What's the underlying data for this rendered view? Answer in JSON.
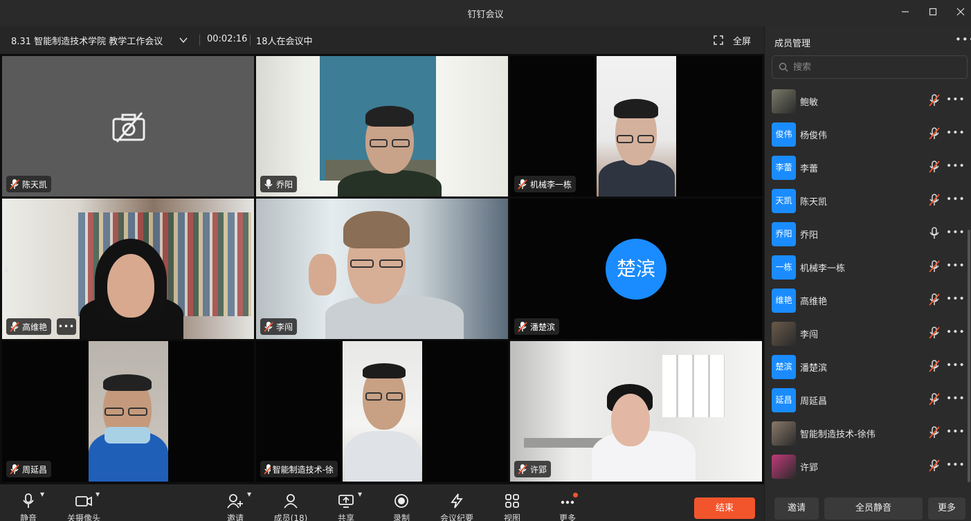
{
  "window": {
    "title": "钉钉会议"
  },
  "meeting": {
    "title": "8.31 智能制造技术学院 教学工作会议",
    "timer": "00:02:16",
    "participants_text": "18人在会议中",
    "fullscreen_label": "全屏"
  },
  "tiles": [
    {
      "name": "陈天凯",
      "mic": "muted",
      "camera": "off"
    },
    {
      "name": "乔阳",
      "mic": "on",
      "camera": "on"
    },
    {
      "name": "机械李一栋",
      "mic": "muted",
      "camera": "on"
    },
    {
      "name": "高维艳",
      "mic": "muted",
      "camera": "on",
      "more": "•••"
    },
    {
      "name": "李闯",
      "mic": "muted",
      "camera": "on"
    },
    {
      "name": "潘楚滨",
      "mic": "muted",
      "camera": "off",
      "avatar": "楚滨"
    },
    {
      "name": "周延昌",
      "mic": "muted",
      "camera": "on"
    },
    {
      "name": "智能制造技术-徐",
      "mic": "muted",
      "camera": "on"
    },
    {
      "name": "许郢",
      "mic": "muted",
      "camera": "on"
    }
  ],
  "sidebar": {
    "title": "成员管理",
    "more": "•••",
    "search_placeholder": "搜索",
    "members": [
      {
        "name": "鲍敏",
        "avatar": "",
        "avatar_type": "photo",
        "mic": "muted"
      },
      {
        "name": "杨俊伟",
        "avatar": "俊伟",
        "avatar_type": "text",
        "mic": "muted"
      },
      {
        "name": "李蕾",
        "avatar": "李蕾",
        "avatar_type": "text",
        "mic": "muted"
      },
      {
        "name": "陈天凯",
        "avatar": "天凯",
        "avatar_type": "text",
        "mic": "muted"
      },
      {
        "name": "乔阳",
        "avatar": "乔阳",
        "avatar_type": "text",
        "mic": "on"
      },
      {
        "name": "机械李一栋",
        "avatar": "一栋",
        "avatar_type": "text",
        "mic": "muted"
      },
      {
        "name": "高维艳",
        "avatar": "维艳",
        "avatar_type": "text",
        "mic": "muted"
      },
      {
        "name": "李闯",
        "avatar": "",
        "avatar_type": "photo",
        "mic": "muted"
      },
      {
        "name": "潘楚滨",
        "avatar": "楚滨",
        "avatar_type": "text",
        "mic": "muted"
      },
      {
        "name": "周延昌",
        "avatar": "延昌",
        "avatar_type": "text",
        "mic": "muted"
      },
      {
        "name": "智能制造技术-徐伟",
        "avatar": "",
        "avatar_type": "photo",
        "mic": "muted"
      },
      {
        "name": "许郢",
        "avatar": "",
        "avatar_type": "photo",
        "mic": "muted"
      }
    ],
    "buttons": {
      "invite": "邀请",
      "mute_all": "全员静音",
      "more": "更多"
    }
  },
  "toolbar": {
    "mute": "静音",
    "camera_off": "关摄像头",
    "invite": "邀请",
    "members": "成员(18)",
    "share": "共享",
    "record": "录制",
    "minutes": "会议纪要",
    "view": "视图",
    "more": "更多",
    "end": "结束"
  },
  "colors": {
    "accent": "#1a8cff",
    "end": "#f2552c",
    "muted": "#f2552c"
  }
}
